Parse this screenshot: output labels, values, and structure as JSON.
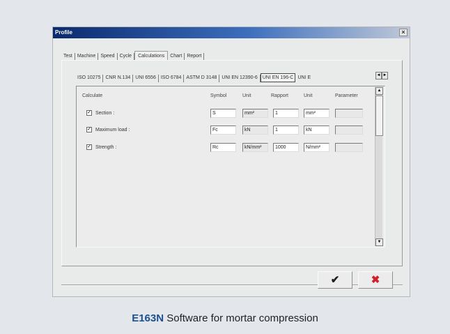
{
  "window": {
    "title": "Profile",
    "close_glyph": "×"
  },
  "top_tabs": [
    "Test",
    "Machine",
    "Speed",
    "Cycle",
    "Calculations",
    "Chart",
    "Report"
  ],
  "sub_tabs": [
    "ISO 10275",
    "CNR N.134",
    "UNI 6556",
    "ISO 6784",
    "ASTM D 3148",
    "UNI EN 12390-6",
    "UNI EN 196-C",
    "UNI E"
  ],
  "sub_tab_scroll": {
    "left": "◄",
    "right": "►"
  },
  "grid_header": {
    "calculate": "Calculate",
    "symbol": "Symbol",
    "unit": "Unit",
    "rapport": "Rapport",
    "unit2": "Unit",
    "parameter": "Parameter"
  },
  "rows": [
    {
      "label": "Section :",
      "checked": "✓",
      "symbol": "S",
      "unit": "mm²",
      "rapport": "1",
      "unit2": "mm²",
      "parameter": ""
    },
    {
      "label": "Maximum load :",
      "checked": "✓",
      "symbol": "Fc",
      "unit": "kN",
      "rapport": "1",
      "unit2": "kN",
      "parameter": ""
    },
    {
      "label": "Strength :",
      "checked": "✓",
      "symbol": "Rc",
      "unit": "kN/mm²",
      "rapport": "1000",
      "unit2": "N/mm²",
      "parameter": ""
    }
  ],
  "scroll": {
    "up": "▲",
    "down": "▼"
  },
  "buttons": {
    "ok": "✔",
    "cancel": "✖"
  },
  "caption": {
    "model": "E163N",
    "text": " Software for mortar compression"
  },
  "colors": {
    "title_bar": "#0a2a6e",
    "caption_model": "#1c4f91",
    "cancel": "#d0202a"
  }
}
